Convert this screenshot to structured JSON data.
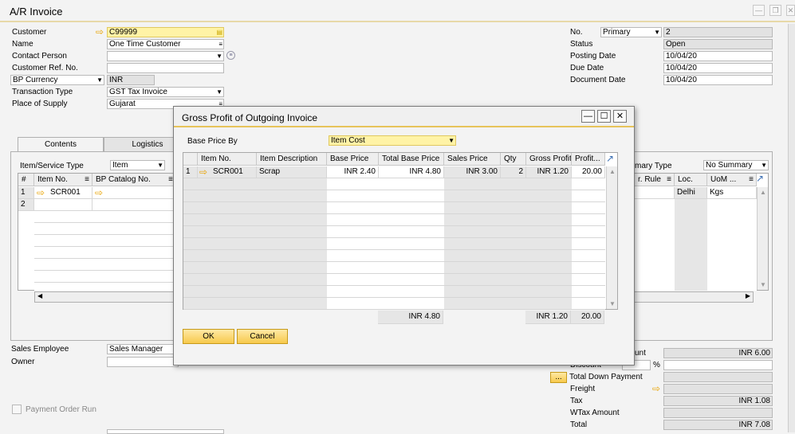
{
  "window": {
    "title": "A/R Invoice"
  },
  "header_left": {
    "customer_label": "Customer",
    "customer_value": "C99999",
    "name_label": "Name",
    "name_value": "One Time Customer",
    "contact_label": "Contact Person",
    "contact_value": "",
    "custref_label": "Customer Ref. No.",
    "custref_value": "",
    "currency_label": "BP Currency",
    "currency_value": "INR",
    "trans_label": "Transaction Type",
    "trans_value": "GST Tax Invoice",
    "supply_label": "Place of Supply",
    "supply_value": "Gujarat"
  },
  "header_right": {
    "no_label": "No.",
    "series_value": "Primary",
    "no_value": "2",
    "status_label": "Status",
    "status_value": "Open",
    "posting_label": "Posting Date",
    "posting_value": "10/04/20",
    "due_label": "Due Date",
    "due_value": "10/04/20",
    "doc_label": "Document Date",
    "doc_value": "10/04/20"
  },
  "tabs": [
    "Contents",
    "Logistics"
  ],
  "contents": {
    "itemtype_label": "Item/Service Type",
    "itemtype_value": "Item",
    "summary_label": "mary Type",
    "summary_value": "No Summary",
    "columns": [
      "#",
      "Item No.",
      "BP Catalog No."
    ],
    "right_columns": [
      "r. Rule",
      "Loc.",
      "UoM ..."
    ],
    "rows": [
      {
        "num": "1",
        "item": "SCR001",
        "loc": "Delhi",
        "uom": "Kgs"
      },
      {
        "num": "2",
        "item": "",
        "loc": "",
        "uom": ""
      }
    ]
  },
  "footer_left": {
    "sales_emp_label": "Sales Employee",
    "sales_emp_value": "Sales Manager",
    "owner_label": "Owner",
    "owner_value": "",
    "payment_label": "Payment Order Run"
  },
  "footer_right": {
    "unt_label": "unt",
    "unt_value": "INR 6.00",
    "discount_label": "Discount",
    "discount_pct": "%",
    "downpay_btn": "...",
    "downpay_label": "Total Down Payment",
    "freight_label": "Freight",
    "tax_label": "Tax",
    "tax_value": "INR 1.08",
    "wtax_label": "WTax Amount",
    "total_label": "Total",
    "total_value": "INR 7.08"
  },
  "modal": {
    "title": "Gross Profit of Outgoing Invoice",
    "base_label": "Base Price By",
    "base_value": "Item Cost",
    "columns": [
      "Item No.",
      "Item Description",
      "Base Price",
      "Total Base Price",
      "Sales Price",
      "Qty",
      "Gross Profit",
      "Profit..."
    ],
    "rows": [
      {
        "num": "1",
        "item": "SCR001",
        "desc": "Scrap",
        "base": "INR 2.40",
        "total_base": "INR 4.80",
        "sales": "INR 3.00",
        "qty": "2",
        "gross": "INR 1.20",
        "profit": "20.00"
      }
    ],
    "totals": {
      "total_base": "INR 4.80",
      "gross": "INR 1.20",
      "profit": "20.00"
    },
    "ok": "OK",
    "cancel": "Cancel"
  }
}
